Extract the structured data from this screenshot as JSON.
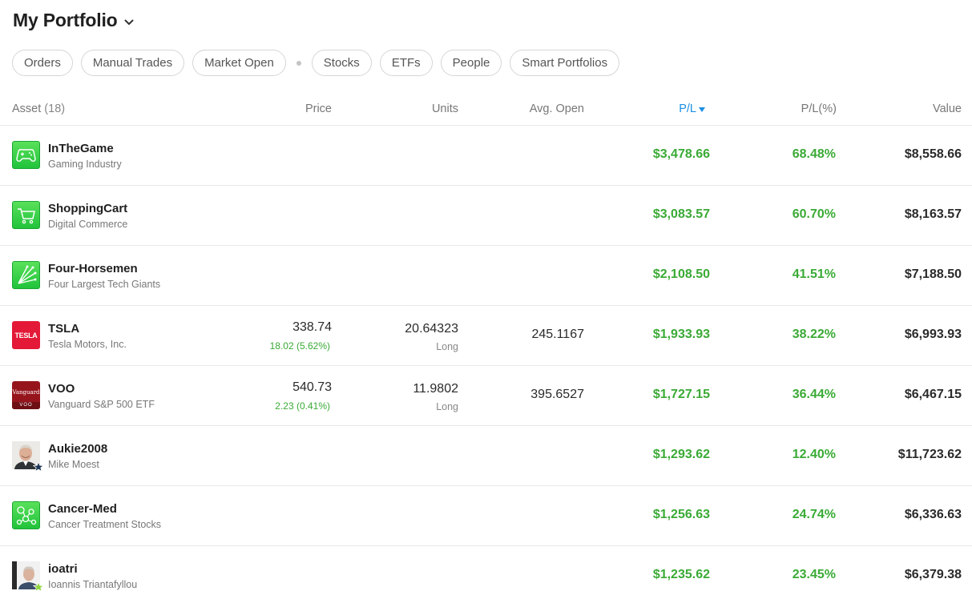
{
  "header": {
    "title": "My Portfolio",
    "dropdown_icon": "chevron-down-icon"
  },
  "filters": [
    {
      "label": "Orders"
    },
    {
      "label": "Manual Trades"
    },
    {
      "label": "Market Open"
    },
    {
      "label": "Stocks"
    },
    {
      "label": "ETFs"
    },
    {
      "label": "People"
    },
    {
      "label": "Smart Portfolios"
    }
  ],
  "table": {
    "headers": {
      "asset": "Asset",
      "asset_count": "(18)",
      "price": "Price",
      "units": "Units",
      "avg_open": "Avg. Open",
      "pl": "P/L",
      "pl_pct": "P/L(%)",
      "value": "Value"
    },
    "rows": [
      {
        "name": "InTheGame",
        "sub": "Gaming Industry",
        "icon": "gamepad-icon",
        "price": "",
        "price_change": "",
        "units": "",
        "direction": "",
        "avg_open": "",
        "pl": "$3,478.66",
        "pl_pct": "68.48%",
        "value": "$8,558.66"
      },
      {
        "name": "ShoppingCart",
        "sub": "Digital Commerce",
        "icon": "shopping-cart-icon",
        "price": "",
        "price_change": "",
        "units": "",
        "direction": "",
        "avg_open": "",
        "pl": "$3,083.57",
        "pl_pct": "60.70%",
        "value": "$8,163.57"
      },
      {
        "name": "Four-Horsemen",
        "sub": "Four Largest Tech Giants",
        "icon": "arrows-icon",
        "price": "",
        "price_change": "",
        "units": "",
        "direction": "",
        "avg_open": "",
        "pl": "$2,108.50",
        "pl_pct": "41.51%",
        "value": "$7,188.50"
      },
      {
        "name": "TSLA",
        "sub": "Tesla Motors, Inc.",
        "icon": "tesla-logo",
        "icon_text": "TESLA",
        "price": "338.74",
        "price_change": "18.02 (5.62%)",
        "units": "20.64323",
        "direction": "Long",
        "avg_open": "245.1167",
        "pl": "$1,933.93",
        "pl_pct": "38.22%",
        "value": "$6,993.93"
      },
      {
        "name": "VOO",
        "sub": "Vanguard S&P 500 ETF",
        "icon": "vanguard-logo",
        "icon_text": "Vanguard",
        "icon_text2": "VOO",
        "price": "540.73",
        "price_change": "2.23 (0.41%)",
        "units": "11.9802",
        "direction": "Long",
        "avg_open": "395.6527",
        "pl": "$1,727.15",
        "pl_pct": "36.44%",
        "value": "$6,467.15"
      },
      {
        "name": "Aukie2008",
        "sub": "Mike Moest",
        "icon": "avatar",
        "badge": "star-badge-icon",
        "price": "",
        "price_change": "",
        "units": "",
        "direction": "",
        "avg_open": "",
        "pl": "$1,293.62",
        "pl_pct": "12.40%",
        "value": "$11,723.62"
      },
      {
        "name": "Cancer-Med",
        "sub": "Cancer Treatment Stocks",
        "icon": "molecule-icon",
        "price": "",
        "price_change": "",
        "units": "",
        "direction": "",
        "avg_open": "",
        "pl": "$1,256.63",
        "pl_pct": "24.74%",
        "value": "$6,336.63"
      },
      {
        "name": "ioatri",
        "sub": "Ioannis Triantafyllou",
        "icon": "avatar",
        "badge": "star-badge-icon",
        "price": "",
        "price_change": "",
        "units": "",
        "direction": "",
        "avg_open": "",
        "pl": "$1,235.62",
        "pl_pct": "23.45%",
        "value": "$6,379.38"
      }
    ]
  },
  "colors": {
    "positive": "#3aaa35",
    "sort_active": "#1a8fe3",
    "smart_portfolio_green": "#21c33c",
    "tesla_red": "#e31937",
    "vanguard_red": "#96151d"
  }
}
